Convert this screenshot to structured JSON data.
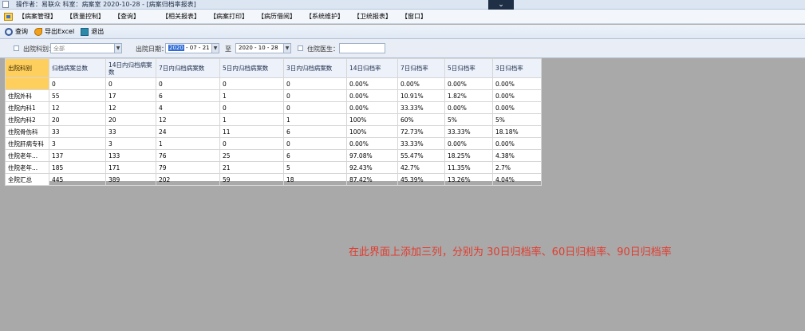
{
  "titlebar": {
    "text": "操作者：易联众   科室：病案室   2020-10-28 - [病案归档率报表]",
    "collapse_icon": "chevron-down-icon"
  },
  "menu": [
    "【病案管理】",
    "【质量控制】",
    "【查询】",
    "【相关报表】",
    "【病案打印】",
    "【病历借阅】",
    "【系统维护】",
    "【卫统报表】",
    "【窗口】"
  ],
  "toolbar": {
    "query_label": "查询",
    "export_label": "导出Excel",
    "exit_label": "退出"
  },
  "filters": {
    "dept_label": "出院科别：",
    "dept_value": "全部",
    "date_label": "出院日期：",
    "date_from_year": "2020",
    "date_from_rest": " - 07 - 21",
    "to_label": "至",
    "date_to": "2020 - 10 - 28",
    "doctor_label": "住院医生："
  },
  "table": {
    "headers": [
      "出院科别",
      "归档病案总数",
      "14日内归档病案数",
      "7日内归档病案数",
      "5日内归档病案数",
      "3日内归档病案数",
      "14日归档率",
      "7日归档率",
      "5日归档率",
      "3日归档率"
    ],
    "rows": [
      [
        "",
        "0",
        "0",
        "0",
        "0",
        "0",
        "0.00%",
        "0.00%",
        "0.00%",
        "0.00%"
      ],
      [
        "住院外科",
        "55",
        "17",
        "6",
        "1",
        "0",
        "0.00%",
        "10.91%",
        "1.82%",
        "0.00%"
      ],
      [
        "住院内科1",
        "12",
        "12",
        "4",
        "0",
        "0",
        "0.00%",
        "33.33%",
        "0.00%",
        "0.00%"
      ],
      [
        "住院内科2",
        "20",
        "20",
        "12",
        "1",
        "1",
        "100%",
        "60%",
        "5%",
        "5%"
      ],
      [
        "住院骨伤科",
        "33",
        "33",
        "24",
        "11",
        "6",
        "100%",
        "72.73%",
        "33.33%",
        "18.18%"
      ],
      [
        "住院肝病专科",
        "3",
        "3",
        "1",
        "0",
        "0",
        "0.00%",
        "33.33%",
        "0.00%",
        "0.00%"
      ],
      [
        "住院老年...",
        "137",
        "133",
        "76",
        "25",
        "6",
        "97.08%",
        "55.47%",
        "18.25%",
        "4.38%"
      ],
      [
        "住院老年...",
        "185",
        "171",
        "79",
        "21",
        "5",
        "92.43%",
        "42.7%",
        "11.35%",
        "2.7%"
      ],
      [
        "全院汇总",
        "445",
        "389",
        "202",
        "59",
        "18",
        "87.42%",
        "45.39%",
        "13.26%",
        "4.04%"
      ]
    ]
  },
  "annotation": "在此界面上添加三列，分别为  30日归档率、60日归档率、90日归档率",
  "colors": {
    "annotation": "#e23c2e",
    "header_highlight": "#ffcf5e",
    "background": "#a9a9a9"
  }
}
